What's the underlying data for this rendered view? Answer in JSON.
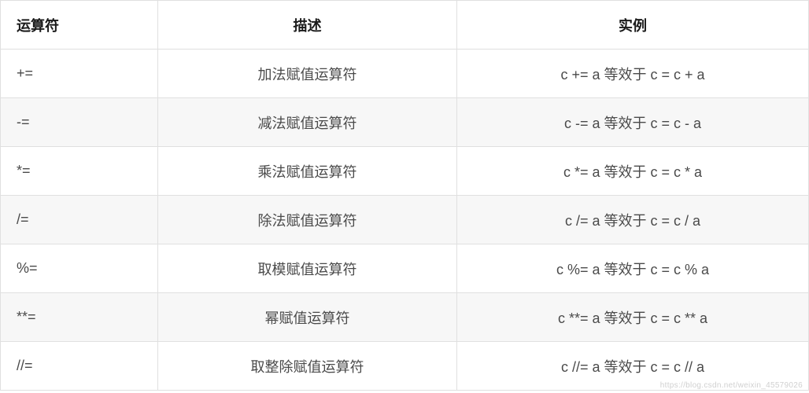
{
  "table": {
    "headers": [
      "运算符",
      "描述",
      "实例"
    ],
    "rows": [
      {
        "operator": "+=",
        "description": "加法赋值运算符",
        "example": "c += a 等效于 c = c + a"
      },
      {
        "operator": "-=",
        "description": "减法赋值运算符",
        "example": "c -= a 等效于 c = c - a"
      },
      {
        "operator": "*=",
        "description": "乘法赋值运算符",
        "example": "c *= a 等效于 c = c * a"
      },
      {
        "operator": "/=",
        "description": "除法赋值运算符",
        "example": "c /= a 等效于 c = c / a"
      },
      {
        "operator": "%=",
        "description": "取模赋值运算符",
        "example": "c %= a 等效于 c = c % a"
      },
      {
        "operator": "**=",
        "description": "幂赋值运算符",
        "example": "c **= a 等效于 c = c ** a"
      },
      {
        "operator": "//=",
        "description": "取整除赋值运算符",
        "example": "c //= a 等效于 c = c // a"
      }
    ]
  },
  "watermark": "https://blog.csdn.net/weixin_45579026"
}
